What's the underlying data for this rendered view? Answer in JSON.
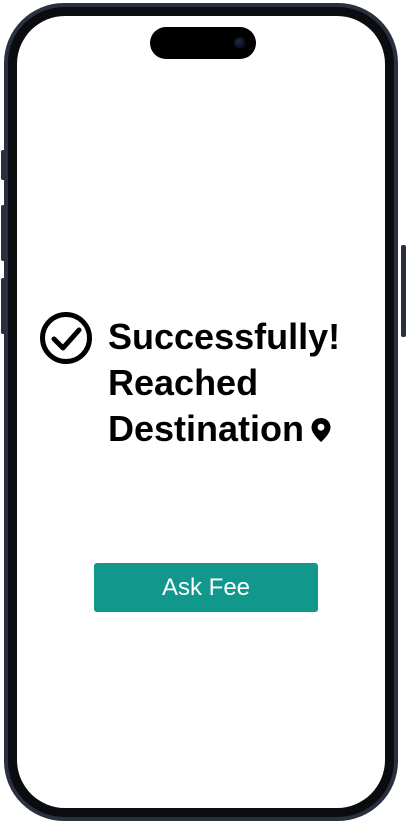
{
  "status": {
    "line1": "Successfully!",
    "line2": "Reached",
    "line3": "Destination",
    "check_icon": "check-circle-icon",
    "location_icon": "location-pin-icon"
  },
  "actions": {
    "ask_fee_label": "Ask Fee"
  },
  "colors": {
    "accent": "#12978c",
    "text": "#000000",
    "background": "#ffffff",
    "device_frame": "#2b3040"
  }
}
